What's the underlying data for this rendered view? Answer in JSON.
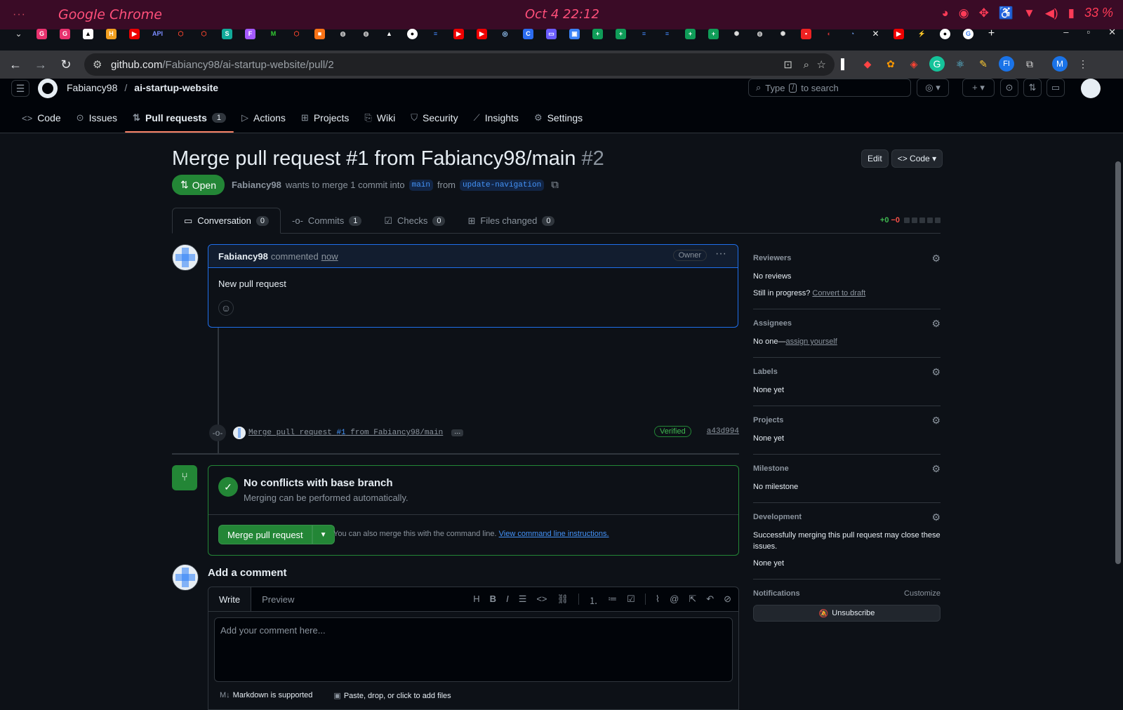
{
  "os_bar": {
    "dots": "···",
    "app_name": "Google Chrome",
    "datetime": "Oct 4  22:12",
    "battery": "33 %"
  },
  "browser": {
    "url_host": "github.com",
    "url_path": "/Fabiancy98/ai-startup-website/pull/2",
    "profile_initial": "M"
  },
  "repo": {
    "owner": "Fabiancy98",
    "name": "ai-startup-website"
  },
  "search": {
    "prefix": "Type",
    "key": "/",
    "suffix": "to search"
  },
  "repo_tabs": [
    {
      "label": "Code",
      "icon": "code-icon"
    },
    {
      "label": "Issues",
      "icon": "issue-icon"
    },
    {
      "label": "Pull requests",
      "icon": "pull-request-icon",
      "count": "1"
    },
    {
      "label": "Actions",
      "icon": "play-icon"
    },
    {
      "label": "Projects",
      "icon": "table-icon"
    },
    {
      "label": "Wiki",
      "icon": "book-icon"
    },
    {
      "label": "Security",
      "icon": "shield-icon"
    },
    {
      "label": "Insights",
      "icon": "graph-icon"
    },
    {
      "label": "Settings",
      "icon": "gear-icon"
    }
  ],
  "pr": {
    "title": "Merge pull request #1 from Fabiancy98/main",
    "number": "#2",
    "edit_label": "Edit",
    "code_label": "Code",
    "state": "Open",
    "author": "Fabiancy98",
    "meta_text": "wants to merge 1 commit into",
    "base_branch": "main",
    "from_text": "from",
    "head_branch": "update-navigation"
  },
  "pr_tabs": [
    {
      "label": "Conversation",
      "count": "0"
    },
    {
      "label": "Commits",
      "count": "1"
    },
    {
      "label": "Checks",
      "count": "0"
    },
    {
      "label": "Files changed",
      "count": "0"
    }
  ],
  "diffstat": {
    "added": "+0",
    "removed": "−0"
  },
  "comment": {
    "author": "Fabiancy98",
    "action": "commented",
    "time": "now",
    "role": "Owner",
    "body": "New pull request"
  },
  "commit": {
    "msg_prefix": "Merge pull request",
    "pr_ref": "#1",
    "msg_suffix": "from Fabiancy98/main",
    "ellipsis": "···",
    "verified": "Verified",
    "sha": "a43d994"
  },
  "merge": {
    "status_title": "No conflicts with base branch",
    "status_sub": "Merging can be performed automatically.",
    "button_label": "Merge pull request",
    "cli_text": "You can also merge this with the command line.",
    "cli_link": "View command line instructions."
  },
  "add_comment": {
    "title": "Add a comment",
    "write_tab": "Write",
    "preview_tab": "Preview",
    "placeholder": "Add your comment here...",
    "markdown_note": "Markdown is supported",
    "attach_note": "Paste, drop, or click to add files"
  },
  "sidebar": {
    "reviewers": {
      "title": "Reviewers",
      "value": "No reviews",
      "draft_prefix": "Still in progress?",
      "draft_link": "Convert to draft"
    },
    "assignees": {
      "title": "Assignees",
      "value": "No one—",
      "link": "assign yourself"
    },
    "labels": {
      "title": "Labels",
      "value": "None yet"
    },
    "projects": {
      "title": "Projects",
      "value": "None yet"
    },
    "milestone": {
      "title": "Milestone",
      "value": "No milestone"
    },
    "development": {
      "title": "Development",
      "text": "Successfully merging this pull request may close these issues.",
      "value": "None yet"
    },
    "notifications": {
      "title": "Notifications",
      "customize": "Customize",
      "button": "Unsubscribe"
    }
  },
  "colors": {
    "accent_green": "#238636",
    "link_blue": "#4493f8",
    "tab_underline": "#f78166",
    "os_bar": "#3a0b26"
  }
}
